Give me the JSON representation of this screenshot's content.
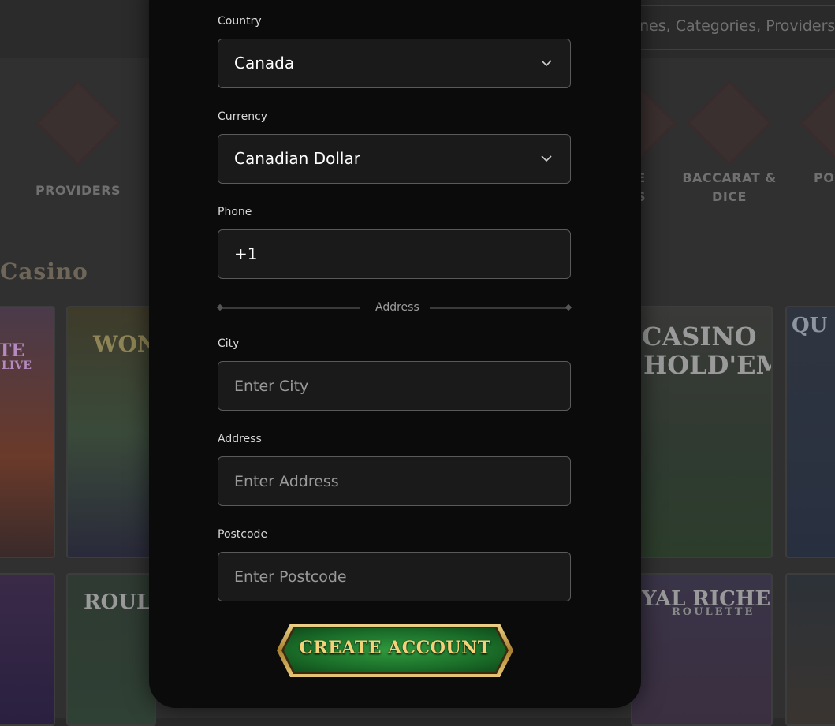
{
  "background": {
    "search_placeholder": "nes, Categories, Providers",
    "categories": [
      {
        "label": "PROVIDERS"
      },
      {
        "label": "E\nS"
      },
      {
        "label": "BACCARAT &\nDICE"
      },
      {
        "label": "PO"
      }
    ],
    "section_title": "Casino",
    "tiles": [
      {
        "text": "CASINO"
      },
      {
        "text": "HOLD'EM"
      },
      {
        "text": "ROULE"
      },
      {
        "text": "YAL RICHES"
      },
      {
        "text": "ROULETTE"
      },
      {
        "text": "WOND"
      },
      {
        "text": "TE"
      },
      {
        "text": "LIVE"
      },
      {
        "text": "QU"
      }
    ]
  },
  "form": {
    "country": {
      "label": "Country",
      "value": "Canada",
      "icon": "chevron-down-icon"
    },
    "currency": {
      "label": "Currency",
      "value": "Canadian Dollar",
      "icon": "chevron-down-icon"
    },
    "phone": {
      "label": "Phone",
      "value": "+1"
    },
    "address_divider": "Address",
    "city": {
      "label": "City",
      "placeholder": "Enter City"
    },
    "address": {
      "label": "Address",
      "placeholder": "Enter Address"
    },
    "postcode": {
      "label": "Postcode",
      "placeholder": "Enter Postcode"
    },
    "submit_label": "CREATE ACCOUNT"
  },
  "colors": {
    "modal_bg": "#0b0b0b",
    "field_bg": "#1a1a1a",
    "button_green": "#1a7a2e",
    "button_gold": "#c9a24a"
  }
}
